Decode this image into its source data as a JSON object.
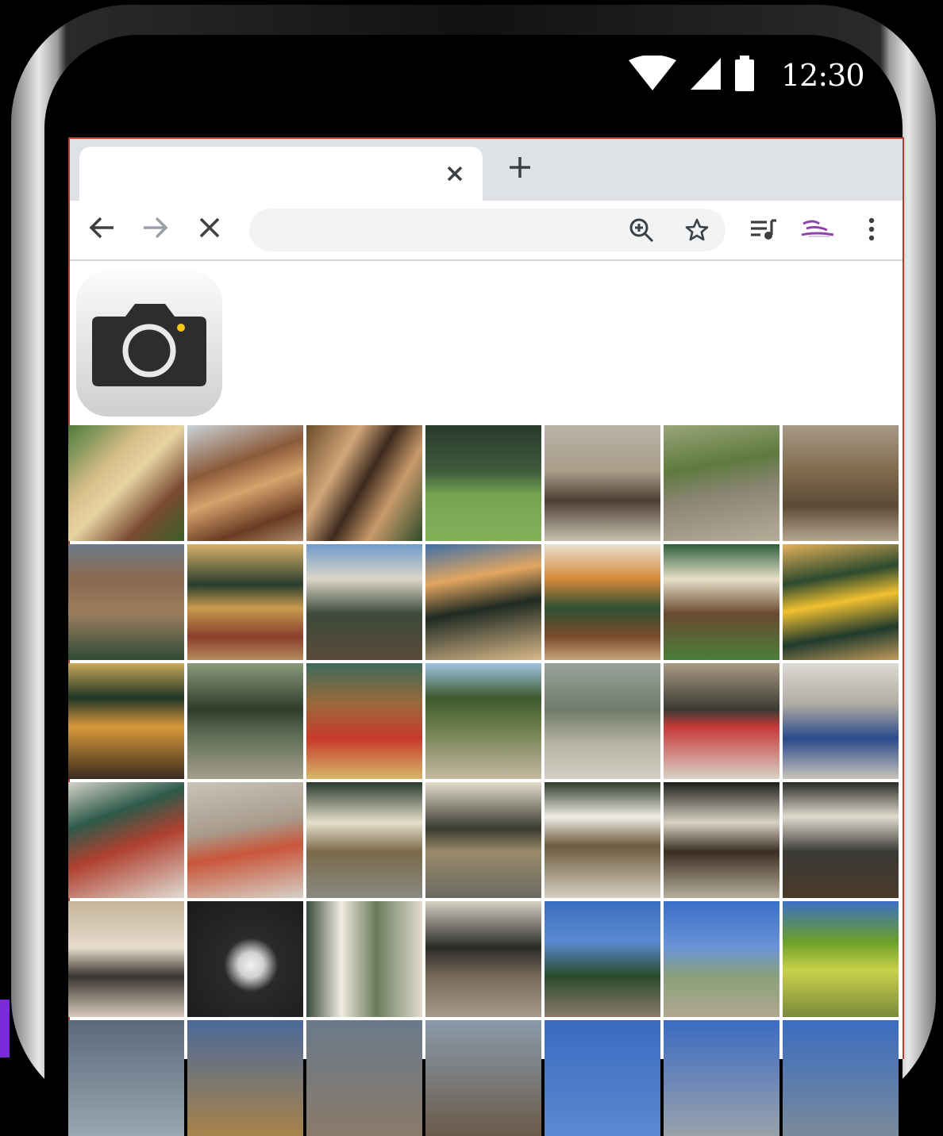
{
  "status_bar": {
    "time": "12:30",
    "icons": [
      "wifi-icon",
      "cellular-signal-icon",
      "battery-icon"
    ]
  },
  "browser": {
    "tab": {
      "title": "",
      "close_icon": "close-icon"
    },
    "new_tab_icon": "plus-icon",
    "toolbar": {
      "back_icon": "arrow-left-icon",
      "forward_icon": "arrow-right-icon",
      "stop_icon": "close-icon",
      "address_value": "",
      "zoom_icon": "zoom-in-icon",
      "bookmark_icon": "star-icon",
      "media_icon": "playlist-music-icon",
      "extension_icon": "extension-icon",
      "menu_icon": "more-vert-icon"
    }
  },
  "page": {
    "camera_app_icon": "camera-icon",
    "photo_count_visible": 42
  },
  "colors": {
    "accent_red": "#c0392b",
    "camera_dot": "#f5c518",
    "tabstrip": "#dee1e6"
  }
}
